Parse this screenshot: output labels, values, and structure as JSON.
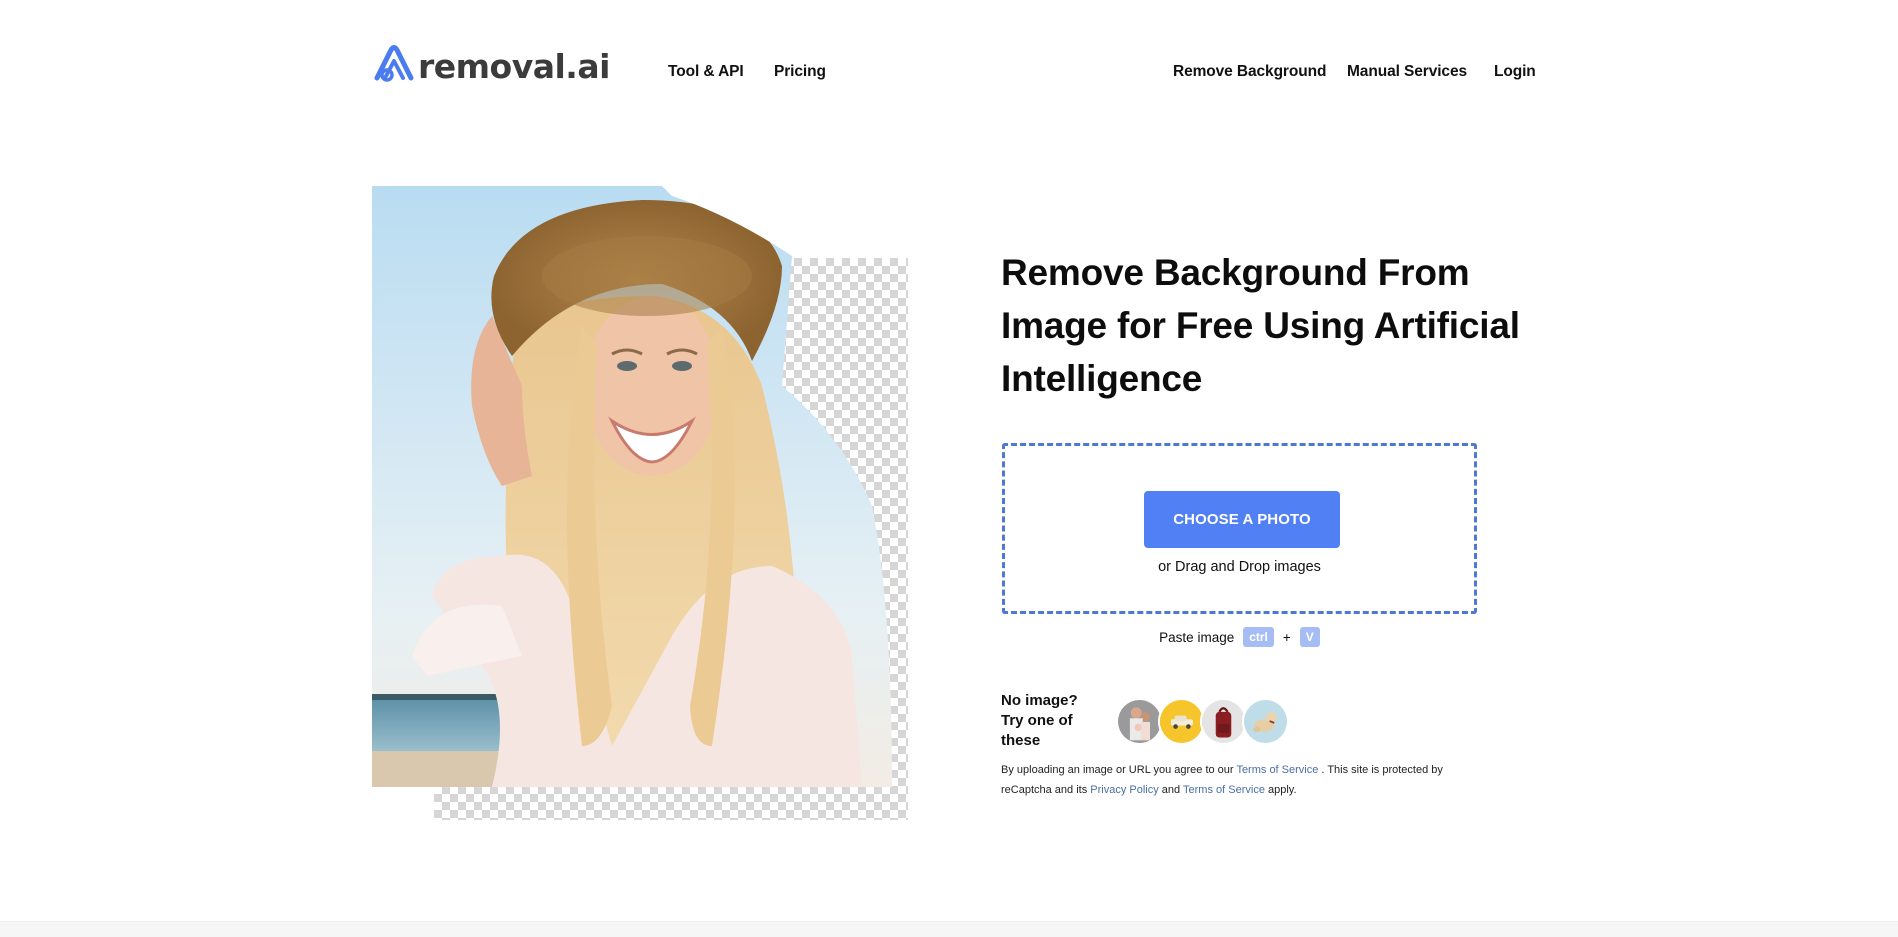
{
  "header": {
    "logo_text": "removal.ai",
    "nav_left": [
      {
        "label": "Tool & API"
      },
      {
        "label": "Pricing"
      }
    ],
    "nav_right": [
      {
        "label": "Remove Background"
      },
      {
        "label": "Manual Services"
      },
      {
        "label": "Login"
      }
    ]
  },
  "hero": {
    "image_alt": "Smiling woman in straw hat on beach with background partially removed",
    "headline": "Remove Background From Image for Free Using Artificial Intelligence"
  },
  "upload": {
    "button_label": "CHOOSE A PHOTO",
    "drop_hint": "or Drag and Drop images",
    "paste_label": "Paste image",
    "paste_key1": "ctrl",
    "paste_plus": "+",
    "paste_key2": "V"
  },
  "samples": {
    "line1": "No image?",
    "line2": "Try one of these",
    "items": [
      {
        "name": "family"
      },
      {
        "name": "car"
      },
      {
        "name": "backpack"
      },
      {
        "name": "dog"
      }
    ]
  },
  "legal": {
    "part1": "By uploading an image or URL you agree to our ",
    "link1": "Terms of Service",
    "part2": " . This site is protected by reCaptcha and its ",
    "link2": "Privacy Policy",
    "part3": " and ",
    "link3": "Terms of Service",
    "part4": " apply."
  },
  "colors": {
    "accent": "#5080f4",
    "dropzone_border": "#4f78d6",
    "kbd_bg": "#a5bcf4",
    "link": "#4a6fa5",
    "logo_blue": "#4a7cf0",
    "logo_text": "#3b3b3b"
  }
}
